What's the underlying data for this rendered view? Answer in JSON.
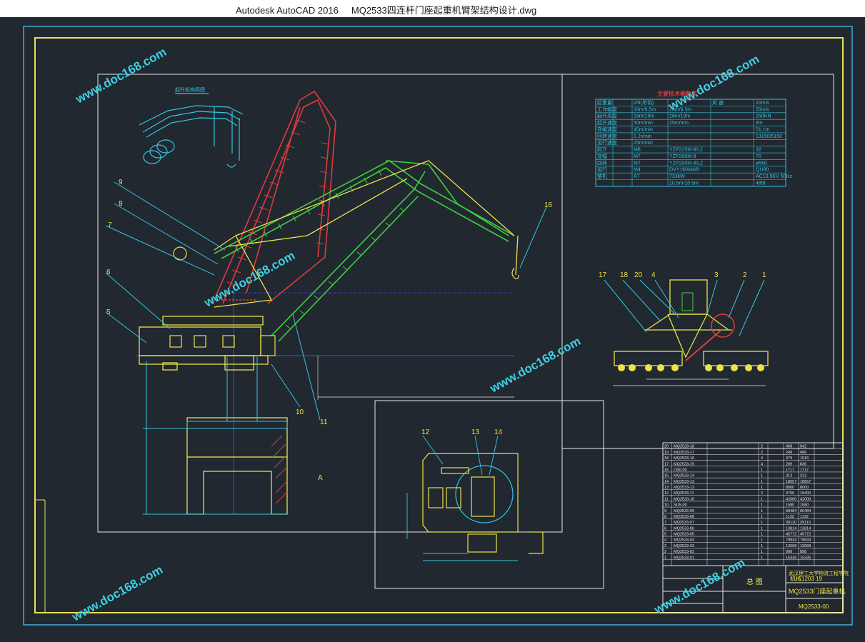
{
  "app": {
    "name": "Autodesk AutoCAD 2016",
    "file": "MQ2533四连杆门座起重机臂架结构设计.dwg"
  },
  "drawing": {
    "top_table_title": "主要技术参数表",
    "mini_title": "起升机构简图",
    "callouts_left": [
      "9",
      "8",
      "7",
      "6",
      "5",
      "10",
      "11",
      "16"
    ],
    "callouts_right": [
      "17",
      "18",
      "20",
      "4",
      "3",
      "2",
      "1"
    ],
    "callouts_bottom": [
      "12",
      "13",
      "14"
    ],
    "section_label": "A",
    "title_block": {
      "school": "武汉理工大学物流工程学院",
      "class": "机械1203 19",
      "drawing_name": "总 图",
      "product": "MQ2533门座起重机",
      "drawing_no": "MQ2533-00"
    },
    "param_rows": [
      [
        "起重量",
        "25t(吊钩)",
        "",
        "风 速",
        "20m/s"
      ],
      [
        "工作幅度",
        "33m/9.5m",
        "25m/9.5m",
        "",
        "55m/s"
      ],
      [
        "起升高度",
        "19m/19m",
        "28m/19m",
        "",
        "250KN"
      ],
      [
        "起升速度",
        "50m/min",
        "25m/min",
        "",
        "9m"
      ],
      [
        "变幅速度",
        "45m/min",
        "",
        "",
        "51.1m"
      ],
      [
        "回转速度",
        "1.2r/min",
        "",
        "",
        "13150/5150"
      ],
      [
        "运行速度",
        "25m/min",
        "",
        "",
        ""
      ],
      [
        "起升",
        "M8",
        "YZP225M-8/L2",
        "",
        "32"
      ],
      [
        "变幅",
        "M7",
        "YZP200M-8",
        "",
        "70"
      ],
      [
        "回转",
        "M7",
        "YZP200M-8/L2",
        "",
        "ø550"
      ],
      [
        "运行",
        "M4",
        "DVY160M4/8",
        "",
        "QU80"
      ],
      [
        "整机",
        "A7",
        "733kW",
        "",
        "AC10.5KV 50Hz"
      ],
      [
        "",
        "",
        "10.5m/10.5m",
        "",
        "485t"
      ]
    ],
    "bom_rows": [
      [
        "20",
        "MQ2533-18",
        "2",
        "468",
        "942"
      ],
      [
        "19",
        "MQ2533-17",
        "2",
        "248",
        "496"
      ],
      [
        "18",
        "MQ2533-16",
        "4",
        "379",
        "1516"
      ],
      [
        "17",
        "MQ2533-15",
        "4",
        "209",
        "836"
      ],
      [
        "16",
        "CB0-00",
        "1",
        "1717",
        "1717"
      ],
      [
        "15",
        "MQ2533-14",
        "1",
        "313",
        "313"
      ],
      [
        "14",
        "MQ2533-13",
        "1",
        "18657",
        "18657"
      ],
      [
        "13",
        "MQ2533-12",
        "1",
        "8000",
        "8000"
      ],
      [
        "12",
        "MQ2533-11",
        "2",
        "9700",
        "19400"
      ],
      [
        "11",
        "MQ2533-10",
        "1",
        "42000",
        "42000"
      ],
      [
        "10",
        "SU5-00",
        "1",
        "1580",
        "1580"
      ],
      [
        "9",
        "MQ2533-09",
        "1",
        "60484",
        "60484"
      ],
      [
        "8",
        "MQ2533-08",
        "1",
        "1132",
        "1132"
      ],
      [
        "7",
        "MQ2533-07",
        "1",
        "39110",
        "39110"
      ],
      [
        "6",
        "MQ2533-06",
        "1",
        "13814",
        "13814"
      ],
      [
        "5",
        "MQ2533-05",
        "1",
        "45772",
        "45772"
      ],
      [
        "4",
        "MQ2533-04",
        "1",
        "79833",
        "79833"
      ],
      [
        "3",
        "MQ2533-03",
        "1",
        "13668",
        "13668"
      ],
      [
        "2",
        "MQ2533-02",
        "1",
        "898",
        "898"
      ],
      [
        "1",
        "MQ2533-01",
        "1",
        "15335",
        "15335"
      ]
    ],
    "watermark": "www.doc168.com"
  },
  "colors": {
    "background": "#212830",
    "frame": "#e8e05a",
    "outer_frame": "#38c8e8",
    "boom_green": "#3ed23e",
    "boom_red": "#e23a3a",
    "structure_yellow": "#ece24a",
    "cyan": "#36c6e0",
    "blue": "#4250ff",
    "watermark": "#3fd0e2"
  }
}
